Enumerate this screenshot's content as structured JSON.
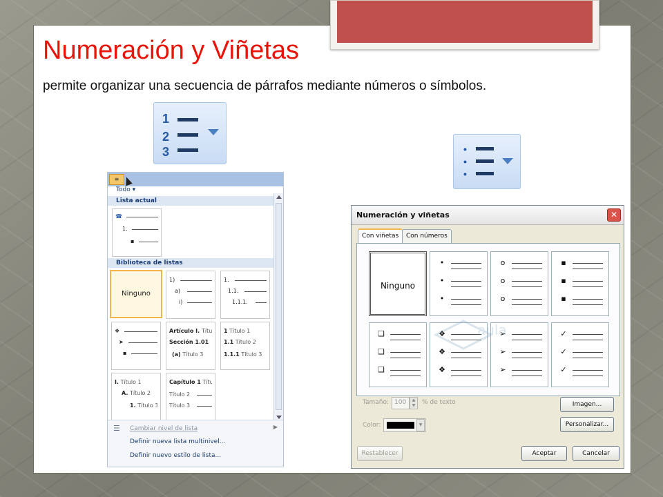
{
  "slide": {
    "title": "Numeración y Viñetas",
    "subtitle": "permite organizar una secuencia de párrafos mediante números o símbolos."
  },
  "numbering_button": {
    "glyphs": [
      "1",
      "2",
      "3"
    ],
    "icon": "numbered-list-icon"
  },
  "bullets_button": {
    "icon": "bulleted-list-icon"
  },
  "multilevel_panel": {
    "filter_label": "Todo",
    "current_section": "Lista actual",
    "current_list": {
      "l1": "1.",
      "l2": "▪"
    },
    "library_section": "Biblioteca de listas",
    "none_label": "Ninguno",
    "numeric": {
      "l1": "1)",
      "l2": "a)",
      "l3": "i)"
    },
    "decimal": {
      "l1": "1.",
      "l2": "1.1.",
      "l3": "1.1.1."
    },
    "symbols": {
      "l1": "❖",
      "l2": "➤",
      "l3": "▪"
    },
    "articles": {
      "l1": "Artículo I.",
      "l1b": "Títul",
      "l2": "Sección 1.01",
      "l3": "(a)",
      "l3b": "Título 3"
    },
    "headings": {
      "l1": "1",
      "l1b": "Título 1",
      "l2": "1.1",
      "l2b": "Título 2",
      "l3": "1.1.1",
      "l3b": "Título 3"
    },
    "roman": {
      "l1": "I.",
      "l1b": "Título 1",
      "l2": "A.",
      "l2b": "Título 2",
      "l3": "1.",
      "l3b": "Título 3"
    },
    "chapter": {
      "l1": "Capítulo 1",
      "l1b": "Títu",
      "l2": "Título 2",
      "l3": "Título 3"
    },
    "menu": {
      "change_level": "Cambiar nivel de lista",
      "define_multilevel": "Definir nueva lista multinivel...",
      "define_style": "Definir nuevo estilo de lista..."
    }
  },
  "dialog": {
    "title": "Numeración y viñetas",
    "tab_bullets": "Con viñetas",
    "tab_numbers": "Con números",
    "none_label": "Ninguno",
    "symbols": {
      "dot": "•",
      "circle": "o",
      "square": "▪",
      "box": "❑",
      "diamond": "❖",
      "arrow": "➢",
      "check": "✓"
    },
    "size_label": "Tamaño:",
    "size_value": "100",
    "size_unit": "% de texto",
    "color_label": "Color:",
    "picture_button": "Imagen...",
    "customize_button": "Personalizar...",
    "reset_button": "Restablecer",
    "ok_button": "Aceptar",
    "cancel_button": "Cancelar",
    "watermark_text": "aula clic"
  },
  "colors": {
    "title": "#e8140a",
    "accent_red": "#c0504d",
    "ribbon_line": "#1f3a63",
    "ribbon_blue": "#2458a6"
  }
}
